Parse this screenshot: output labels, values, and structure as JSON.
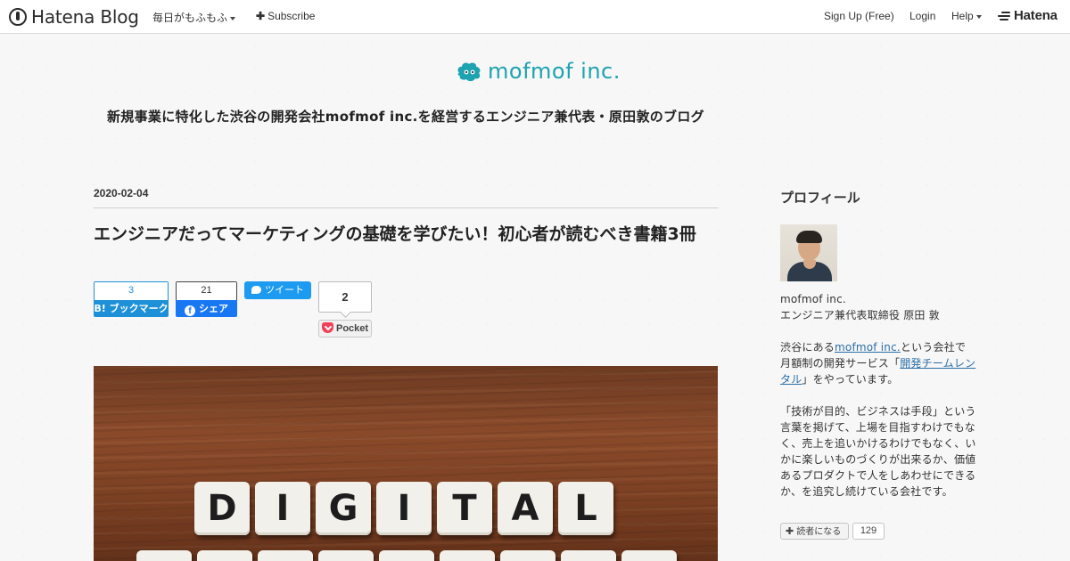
{
  "topbar": {
    "brand": "Hatena Blog",
    "blog_name": "毎日がもふもふ",
    "subscribe": "Subscribe",
    "signup": "Sign Up (Free)",
    "login": "Login",
    "help": "Help",
    "hatena": "Hatena"
  },
  "header": {
    "logo_text": "mofmof inc.",
    "tagline": "新規事業に特化した渋谷の開発会社mofmof inc.を経営するエンジニア兼代表・原田敦のブログ"
  },
  "post": {
    "date": "2020-02-04",
    "title": "エンジニアだってマーケティングの基礎を学びたい！初心者が読むべき書籍3冊",
    "share": {
      "hatena_count": "3",
      "hatena_label": "ブックマーク",
      "facebook_count": "21",
      "facebook_label": "シェア",
      "tweet_label": "ツイート",
      "pocket_count": "2",
      "pocket_label": "Pocket"
    },
    "hero_tiles_row1": [
      "D",
      "I",
      "G",
      "I",
      "T",
      "A",
      "L"
    ]
  },
  "sidebar": {
    "heading": "プロフィール",
    "company": "mofmof inc.",
    "role": "エンジニア兼代表取締役 原田 敦",
    "intro_pre": "渋谷にある",
    "intro_link": "mofmof inc.",
    "intro_mid": "という会社で月額制の開発サービス「",
    "intro_link2": "開発チームレンタル",
    "intro_post": "」をやっています。",
    "description": "「技術が目的、ビジネスは手段」という言葉を掲げて、上場を目指すわけでもなく、売上を追いかけるわけでもなく、いかに楽しいものづくりが出来るか、価値あるプロダクトで人をしあわせにできるか、を追究し続けている会社です。",
    "reader_button": "読者になる",
    "reader_count": "129"
  },
  "colors": {
    "brand_teal": "#1ea3b0",
    "hatena_blue": "#1e90d8",
    "facebook_blue": "#1877f2",
    "twitter_blue": "#1d9bf0",
    "pocket_red": "#ee4056"
  }
}
